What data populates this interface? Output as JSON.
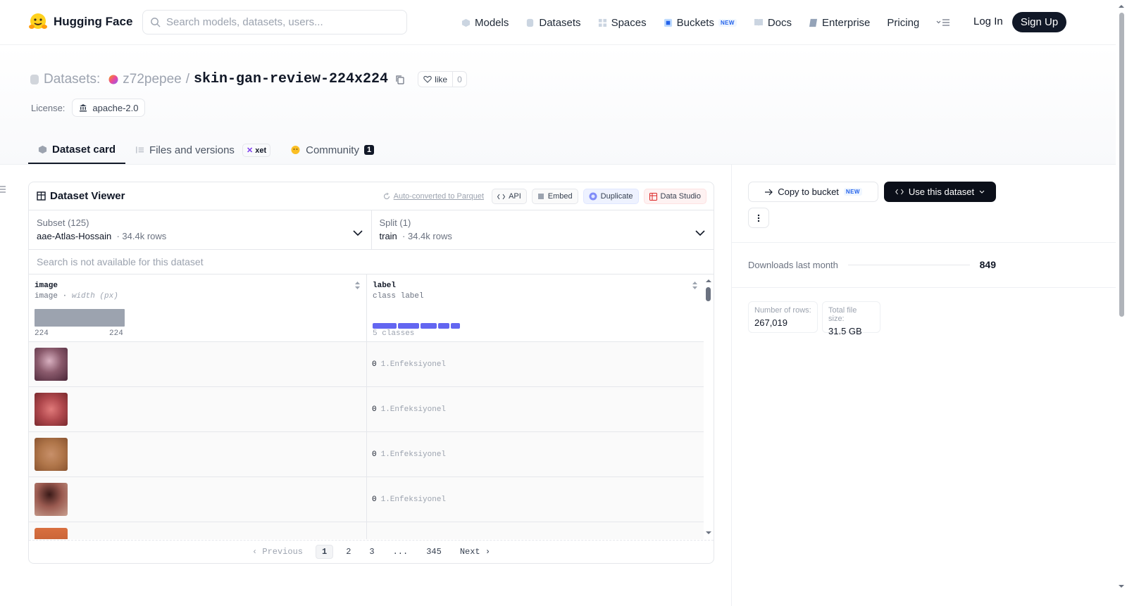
{
  "header": {
    "brand": "Hugging Face",
    "search_placeholder": "Search models, datasets, users...",
    "nav": [
      {
        "label": "Models",
        "icon": "cube-icon"
      },
      {
        "label": "Datasets",
        "icon": "database-icon"
      },
      {
        "label": "Spaces",
        "icon": "grid-icon"
      },
      {
        "label": "Buckets",
        "icon": "bucket-icon",
        "badge": "NEW"
      },
      {
        "label": "Docs",
        "icon": "book-icon"
      },
      {
        "label": "Enterprise",
        "icon": "enterprise-icon"
      },
      {
        "label": "Pricing"
      }
    ],
    "login": "Log In",
    "signup": "Sign Up"
  },
  "repo": {
    "type_label": "Datasets:",
    "owner": "z72pepee",
    "separator": "/",
    "name": "skin-gan-review-224x224",
    "like_label": "like",
    "like_count": "0",
    "license_label": "License:",
    "license": "apache-2.0"
  },
  "tabs": [
    {
      "label": "Dataset card",
      "active": true
    },
    {
      "label": "Files and versions",
      "badge": "xet"
    },
    {
      "label": "Community",
      "count": "1"
    }
  ],
  "viewer": {
    "title": "Dataset Viewer",
    "auto_converted": "Auto-converted to Parquet",
    "actions": [
      "API",
      "Embed",
      "Duplicate",
      "Data Studio"
    ],
    "subset": {
      "label": "Subset (125)",
      "value": "aae-Atlas-Hossain",
      "rows": "34.4k rows"
    },
    "split": {
      "label": "Split (1)",
      "value": "train",
      "rows": "34.4k rows"
    },
    "search_notice": "Search is not available for this dataset",
    "columns": [
      {
        "name": "image",
        "type": "image",
        "subtype": "width (px)",
        "min": "224",
        "max": "224"
      },
      {
        "name": "label",
        "type": "class label",
        "classes": "5 classes"
      }
    ],
    "rows": [
      {
        "label_id": "0",
        "label_name": "1.Enfeksiyonel",
        "thumb_color": "#7a4a5a"
      },
      {
        "label_id": "0",
        "label_name": "1.Enfeksiyonel",
        "thumb_color": "#b0484d"
      },
      {
        "label_id": "0",
        "label_name": "1.Enfeksiyonel",
        "thumb_color": "#b0764a"
      },
      {
        "label_id": "0",
        "label_name": "1.Enfeksiyonel",
        "thumb_color": "#7a3a38"
      }
    ],
    "pagination": {
      "prev": "Previous",
      "pages": [
        "1",
        "2",
        "3",
        "...",
        "345"
      ],
      "current": "1",
      "next": "Next"
    }
  },
  "sidebar": {
    "copy_bucket": "Copy to bucket",
    "copy_badge": "NEW",
    "use_dataset": "Use this dataset",
    "downloads_label": "Downloads last month",
    "downloads": "849",
    "rows_label": "Number of rows:",
    "rows_value": "267,019",
    "size_label": "Total file size:",
    "size_value": "31.5 GB"
  },
  "colors": {
    "primary_dark": "#111827",
    "class_bar": "#6366f1",
    "hist_bar": "#9ca3af"
  }
}
